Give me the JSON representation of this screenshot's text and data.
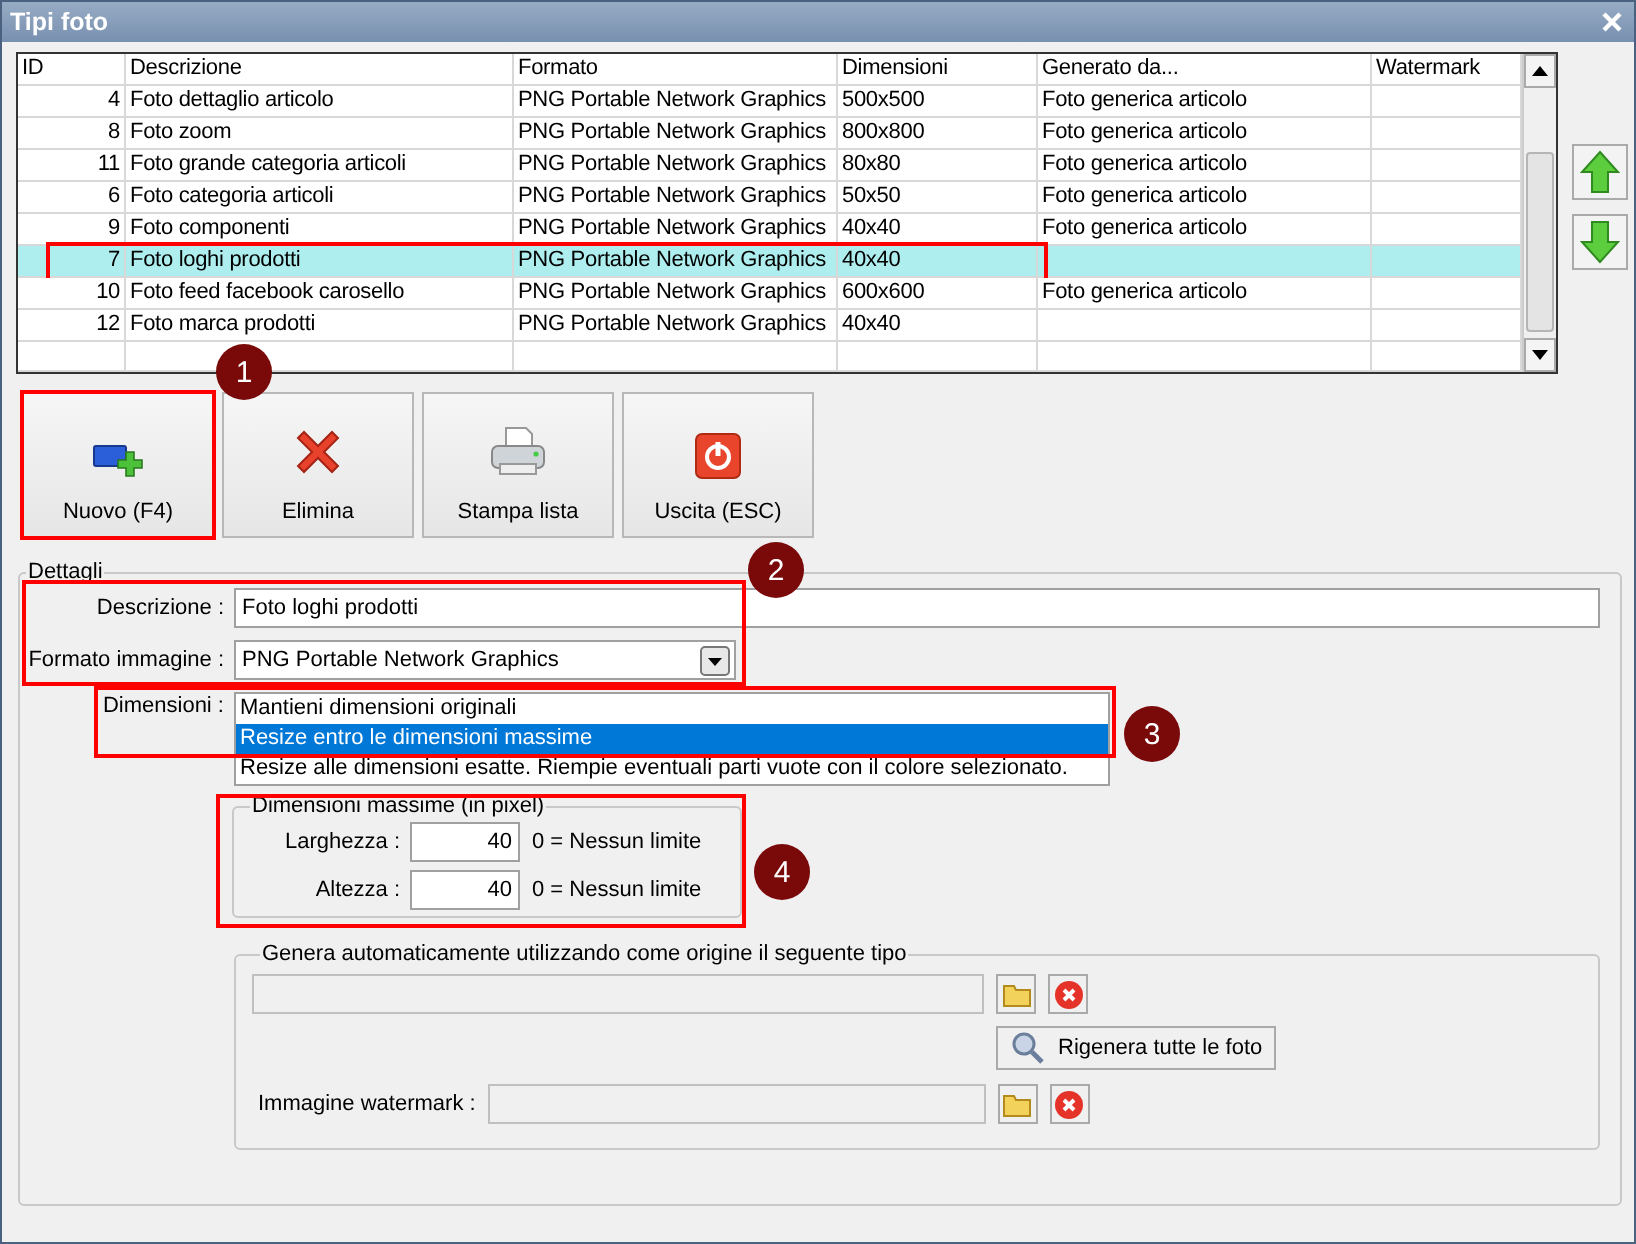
{
  "window": {
    "title": "Tipi foto"
  },
  "table": {
    "columns": [
      "ID",
      "Descrizione",
      "Formato",
      "Dimensioni",
      "Generato da...",
      "Watermark"
    ],
    "rows": [
      {
        "cells": [
          "4",
          "Foto dettaglio articolo",
          "PNG Portable Network Graphics",
          "500x500",
          "Foto generica articolo",
          ""
        ],
        "selected": false
      },
      {
        "cells": [
          "8",
          "Foto zoom",
          "PNG Portable Network Graphics",
          "800x800",
          "Foto generica articolo",
          ""
        ],
        "selected": false
      },
      {
        "cells": [
          "11",
          "Foto grande categoria articoli",
          "PNG Portable Network Graphics",
          "80x80",
          "Foto generica articolo",
          ""
        ],
        "selected": false
      },
      {
        "cells": [
          "6",
          "Foto categoria articoli",
          "PNG Portable Network Graphics",
          "50x50",
          "Foto generica articolo",
          ""
        ],
        "selected": false
      },
      {
        "cells": [
          "9",
          "Foto componenti",
          "PNG Portable Network Graphics",
          "40x40",
          "Foto generica articolo",
          ""
        ],
        "selected": false
      },
      {
        "cells": [
          "7",
          "Foto loghi prodotti",
          "PNG Portable Network Graphics",
          "40x40",
          "",
          ""
        ],
        "selected": true
      },
      {
        "cells": [
          "10",
          "Foto feed facebook carosello",
          "PNG Portable Network Graphics",
          "600x600",
          "Foto generica articolo",
          ""
        ],
        "selected": false
      },
      {
        "cells": [
          "12",
          "Foto marca prodotti",
          "PNG Portable Network Graphics",
          "40x40",
          "",
          ""
        ],
        "selected": false
      }
    ]
  },
  "toolbar": [
    {
      "label": "Nuovo (F4)",
      "kind": "new"
    },
    {
      "label": "Elimina",
      "kind": "delete"
    },
    {
      "label": "Stampa lista",
      "kind": "print"
    },
    {
      "label": "Uscita (ESC)",
      "kind": "exit"
    }
  ],
  "details": {
    "legend": "Dettagli",
    "description": {
      "label": "Descrizione :",
      "value": "Foto loghi prodotti"
    },
    "format": {
      "label": "Formato immagine :",
      "value": "PNG Portable Network Graphics"
    },
    "dimensions": {
      "label": "Dimensioni :",
      "options": [
        {
          "label": "Mantieni dimensioni originali",
          "selected": false
        },
        {
          "label": "Resize entro le dimensioni massime",
          "selected": true
        },
        {
          "label": "Resize alle dimensioni esatte. Riempie eventuali parti vuote con il colore selezionato.",
          "selected": false
        }
      ]
    },
    "max_size": {
      "legend": "Dimensioni massime (in pixel)",
      "fields": [
        {
          "label": "Larghezza :",
          "value": "40",
          "hint": "0 = Nessun limite"
        },
        {
          "label": "Altezza :",
          "value": "40",
          "hint": "0 = Nessun limite"
        }
      ]
    },
    "auto_generate": {
      "legend": "Genera automaticamente utilizzando come origine il seguente tipo",
      "regenerate_button": "Rigenera tutte le foto",
      "watermark_label": "Immagine watermark :"
    }
  },
  "callouts": [
    {
      "number": "1"
    },
    {
      "number": "2"
    },
    {
      "number": "3"
    },
    {
      "number": "4"
    }
  ]
}
